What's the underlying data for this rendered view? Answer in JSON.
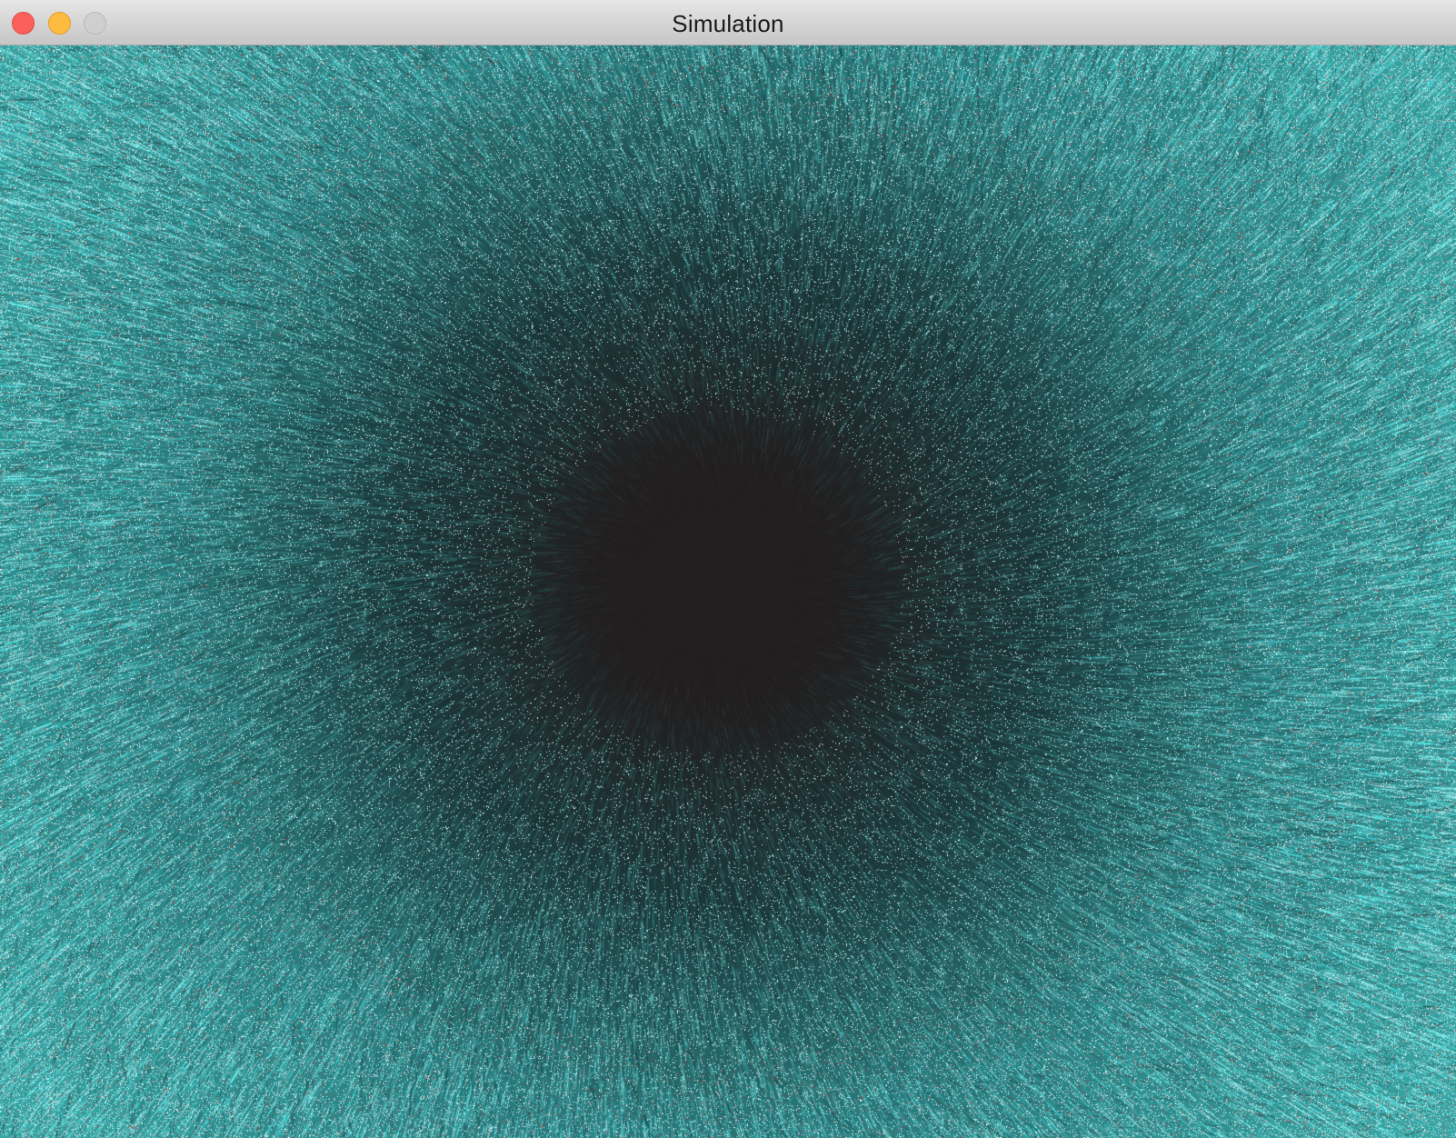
{
  "window": {
    "title": "Simulation",
    "controls": {
      "close_icon": "close-circle-icon",
      "minimize_icon": "minimize-circle-icon",
      "zoom_icon": "zoom-circle-icon"
    }
  },
  "simulation": {
    "description_colors": {
      "particle": "#4fd6d6",
      "particle_bright": "#a8f4f4",
      "accent_red": "#c83a3a",
      "core": "#231e1f"
    }
  }
}
